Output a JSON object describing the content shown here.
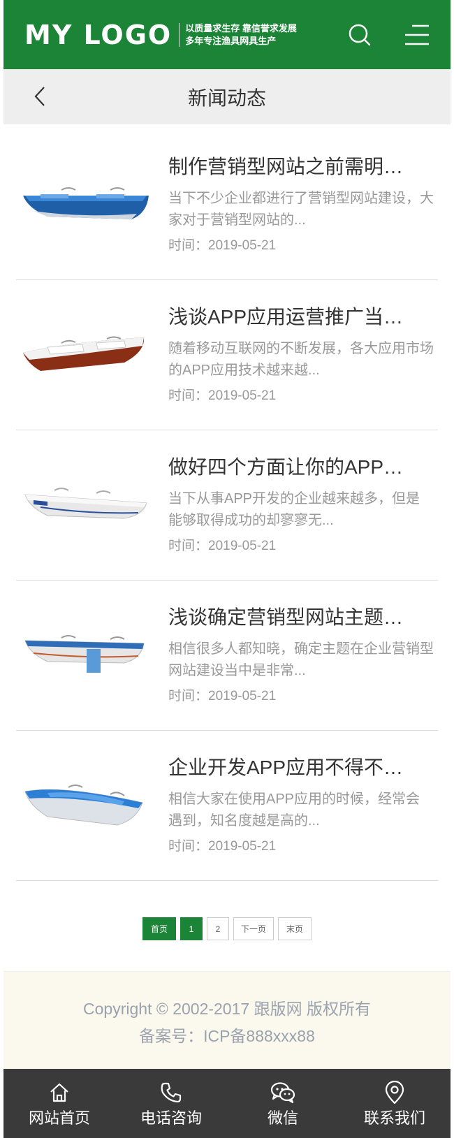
{
  "header": {
    "logo": "MY LOGO",
    "slogan_line1": "以质量求生存 靠信誉求发展",
    "slogan_line2": "多年专注渔具网具生产",
    "brand_color": "#1b8436"
  },
  "titlebar": {
    "title": "新闻动态"
  },
  "news": [
    {
      "title": "制作营销型网站之前需明…",
      "desc": "当下不少企业都进行了营销型网站建设，大家对于营销型网站的...",
      "date": "时间：2019-05-21",
      "boat": "blue-hull"
    },
    {
      "title": "浅谈APP应用运营推广当…",
      "desc": "随着移动互联网的不断发展，各大应用市场的APP应用技术越来越...",
      "date": "时间：2019-05-21",
      "boat": "red-hull"
    },
    {
      "title": "做好四个方面让你的APP…",
      "desc": "当下从事APP开发的企业越来越多，但是能够取得成功的却寥寥无...",
      "date": "时间：2019-05-21",
      "boat": "white-hull"
    },
    {
      "title": "浅谈确定营销型网站主题…",
      "desc": "相信很多人都知晓，确定主题在企业营销型网站建设当中是非常...",
      "date": "时间：2019-05-21",
      "boat": "blue-white"
    },
    {
      "title": "企业开发APP应用不得不…",
      "desc": "相信大家在使用APP应用的时候，经常会遇到，知名度越是高的...",
      "date": "时间：2019-05-21",
      "boat": "blue-top"
    }
  ],
  "pager": {
    "first": "首页",
    "page1": "1",
    "page2": "2",
    "next": "下一页",
    "last": "末页"
  },
  "footer": {
    "copyright": "Copyright © 2002-2017 跟版网 版权所有",
    "icp": "备案号：ICP备888xxx88"
  },
  "bottom_nav": {
    "home": "网站首页",
    "phone": "电话咨询",
    "wechat": "微信",
    "contact": "联系我们"
  }
}
